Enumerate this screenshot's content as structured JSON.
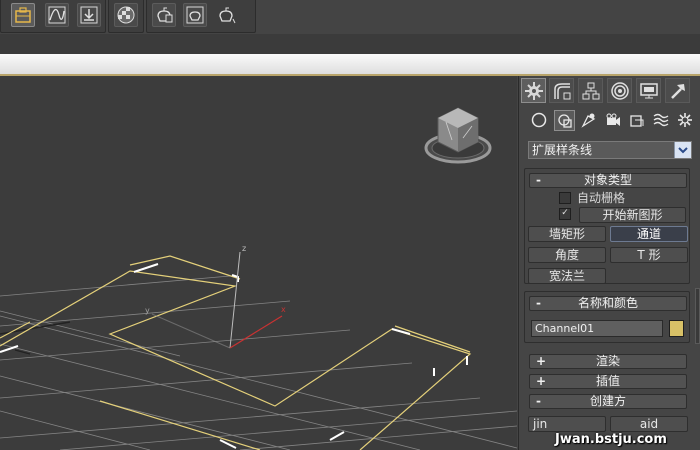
{
  "colors": {
    "viewport_bg": "#3c3c3c",
    "grid_line": "#8a8a8a",
    "shape_yellow": "#e4d07a",
    "axis_red": "#c83232",
    "object_color": "#d8c167",
    "pressed_button": "#3a3f4a"
  },
  "toolbar": {
    "buttons": [
      {
        "icon": "scene-explorer-icon",
        "active": true
      },
      {
        "icon": "curve-editor-icon",
        "active": false
      },
      {
        "icon": "schematic-view-icon",
        "active": false
      },
      {
        "icon": "material-editor-icon",
        "active": false
      },
      {
        "icon": "render-setup-icon",
        "active": false
      },
      {
        "icon": "render-frame-icon",
        "active": false
      },
      {
        "icon": "render-production-icon",
        "active": false
      }
    ]
  },
  "command_panel": {
    "tabs": [
      {
        "icon": "create-tab-icon",
        "active": true
      },
      {
        "icon": "modify-tab-icon",
        "active": false
      },
      {
        "icon": "hierarchy-tab-icon",
        "active": false
      },
      {
        "icon": "motion-tab-icon",
        "active": false
      },
      {
        "icon": "display-tab-icon",
        "active": false
      },
      {
        "icon": "utilities-tab-icon",
        "active": false
      }
    ],
    "create_types": [
      {
        "icon": "geometry-icon",
        "active": false
      },
      {
        "icon": "shapes-icon",
        "active": true
      },
      {
        "icon": "lights-icon",
        "active": false
      },
      {
        "icon": "cameras-icon",
        "active": false
      },
      {
        "icon": "helpers-icon",
        "active": false
      },
      {
        "icon": "space-warps-icon",
        "active": false
      },
      {
        "icon": "systems-icon",
        "active": false
      }
    ],
    "category": "扩展样条线",
    "object_type": {
      "title": "对象类型",
      "sign": "-",
      "auto_grid_label": "自动栅格",
      "auto_grid_checked": false,
      "start_new_shape_label": "开始新图形",
      "start_new_shape_checked": true,
      "checkmark": "✓",
      "buttons": {
        "wall_rectangle": "墙矩形",
        "channel": "通道",
        "angle": "角度",
        "tee": "T 形",
        "wide_flange": "宽法兰"
      }
    },
    "name_and_color": {
      "title": "名称和颜色",
      "sign": "-",
      "name_value": "Channel01"
    },
    "collapsed_rollouts": [
      {
        "sign": "+",
        "title": "渲染"
      },
      {
        "sign": "+",
        "title": "插值"
      },
      {
        "sign": "-",
        "title": "创建方"
      }
    ],
    "bottom_row": {
      "left": "jin",
      "right": "aid"
    }
  },
  "viewport": {
    "axis_labels": {
      "x": "x",
      "y": "y",
      "z": "z"
    }
  },
  "watermark": "Jwan.bstju.com"
}
